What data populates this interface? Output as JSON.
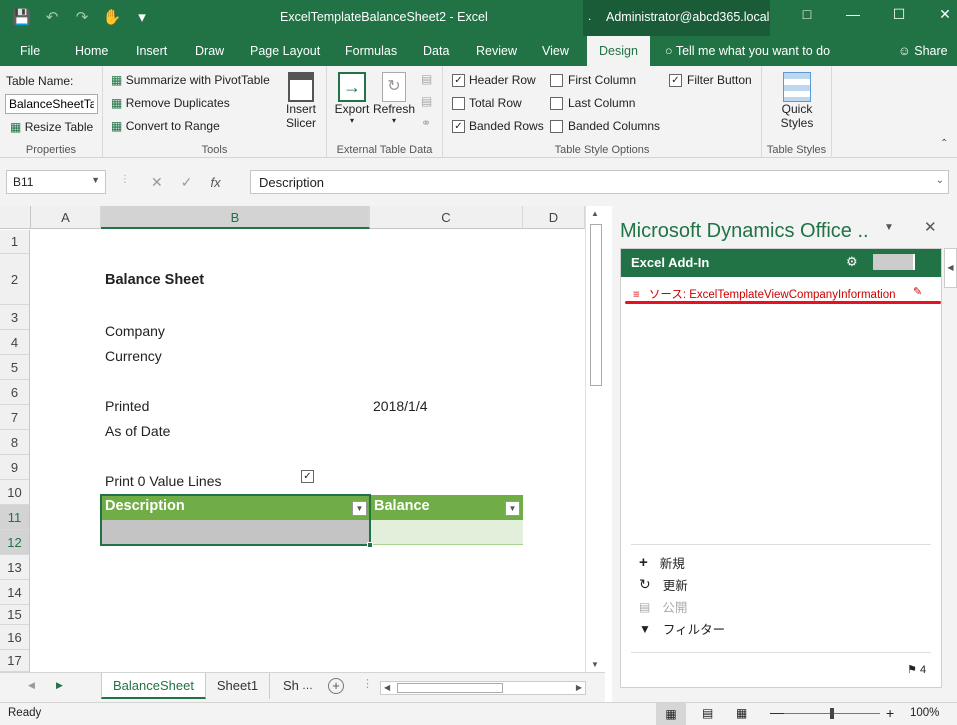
{
  "window": {
    "doc_title": "ExcelTemplateBalanceSheet2  -  Excel",
    "account": "Administrator@abcd365.local"
  },
  "ribbon_tabs": [
    "File",
    "Home",
    "Insert",
    "Draw",
    "Page Layout",
    "Formulas",
    "Data",
    "Review",
    "View",
    "Design"
  ],
  "tell_me": "Tell me what you want to do",
  "share": "Share",
  "ribbon": {
    "properties": {
      "table_name_label": "Table Name:",
      "table_name_value": "BalanceSheetTable",
      "resize": "Resize Table",
      "label": "Properties"
    },
    "tools": {
      "summarize": "Summarize with PivotTable",
      "remove_dup": "Remove Duplicates",
      "convert": "Convert to Range",
      "insert_slicer_1": "Insert",
      "insert_slicer_2": "Slicer",
      "label": "Tools"
    },
    "external": {
      "export": "Export",
      "refresh": "Refresh",
      "label": "External Table Data"
    },
    "style_options": {
      "header_row": "Header Row",
      "total_row": "Total Row",
      "banded_rows": "Banded Rows",
      "first_column": "First Column",
      "last_column": "Last Column",
      "banded_columns": "Banded Columns",
      "filter_button": "Filter Button",
      "label": "Table Style Options"
    },
    "table_styles": {
      "quick_1": "Quick",
      "quick_2": "Styles",
      "label": "Table Styles"
    }
  },
  "formula_bar": {
    "name_box": "B11",
    "fx": "fx",
    "value": "Description"
  },
  "grid": {
    "columns": [
      "A",
      "B",
      "C",
      "D"
    ],
    "rows": [
      "1",
      "2",
      "3",
      "4",
      "5",
      "6",
      "7",
      "8",
      "9",
      "10",
      "11",
      "12",
      "13",
      "14",
      "15",
      "16",
      "17"
    ],
    "cells": {
      "b2": "Balance Sheet",
      "b4": "Company",
      "b5": "Currency",
      "b7": "Printed",
      "c7": "2018/1/4",
      "b8": "As of Date",
      "b10": "Print 0 Value Lines",
      "b11": "Description",
      "c11": "Balance"
    }
  },
  "sheets": [
    "BalanceSheet",
    "Sheet1",
    "Sh"
  ],
  "status": {
    "ready": "Ready",
    "zoom": "100%"
  },
  "pane": {
    "title": "Microsoft Dynamics Office ..",
    "addin": "Excel Add-In",
    "source": "ソース: ExcelTemplateViewCompanyInformation",
    "actions": {
      "new": "新規",
      "refresh": "更新",
      "publish": "公開",
      "filter": "フィルター"
    },
    "flag_count": "4"
  },
  "colors": {
    "excel_green": "#217346",
    "table_header": "#70ad47",
    "annotation_red": "#e81123"
  }
}
